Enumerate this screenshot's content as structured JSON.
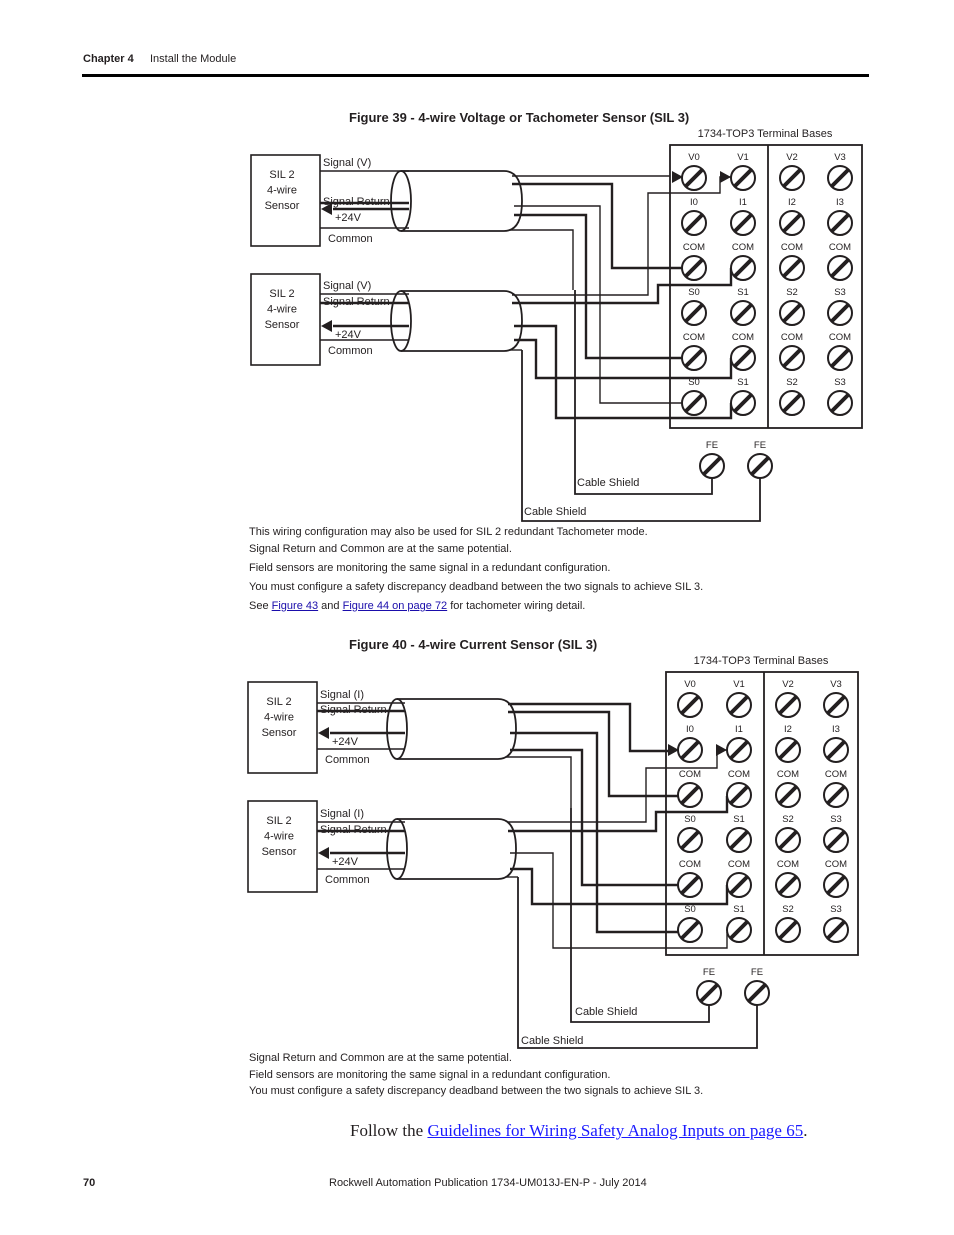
{
  "header": {
    "chapter": "Chapter 4",
    "section": "Install the Module"
  },
  "figure39": {
    "title": "Figure 39 - 4-wire Voltage or Tachometer Sensor (SIL 3)",
    "terminal_base_label": "1734-TOP3 Terminal Bases",
    "sensor_label": [
      "SIL 2",
      "4-wire",
      "Sensor"
    ],
    "wire_labels": [
      "Signal (V)",
      "Signal Return",
      "+24V",
      "Common"
    ],
    "terminal_rows": [
      [
        "V0",
        "V1",
        "V2",
        "V3"
      ],
      [
        "I0",
        "I1",
        "I2",
        "I3"
      ],
      [
        "COM",
        "COM",
        "COM",
        "COM"
      ],
      [
        "S0",
        "S1",
        "S2",
        "S3"
      ],
      [
        "COM",
        "COM",
        "COM",
        "COM"
      ],
      [
        "S0",
        "S1",
        "S2",
        "S3"
      ]
    ],
    "fe_labels": [
      "FE",
      "FE"
    ],
    "shield_label": "Cable Shield",
    "notes": [
      "This wiring configuration may also be used for SIL 2 redundant Tachometer mode.",
      "Signal Return and Common are at the same potential.",
      "Field sensors are monitoring the same signal in a redundant configuration.",
      "You must configure a safety discrepancy deadband between the two signals to achieve SIL 3."
    ],
    "see_note": {
      "prefix": "See ",
      "link1": "Figure 43",
      "mid": " and ",
      "link2": "Figure 44 on page 72",
      "suffix": " for tachometer wiring detail."
    }
  },
  "figure40": {
    "title": "Figure 40 - 4-wire Current Sensor (SIL 3)",
    "terminal_base_label": "1734-TOP3 Terminal Bases",
    "sensor_label": [
      "SIL 2",
      "4-wire",
      "Sensor"
    ],
    "wire_labels": [
      "Signal (I)",
      "Signal Return",
      "+24V",
      "Common"
    ],
    "terminal_rows": [
      [
        "V0",
        "V1",
        "V2",
        "V3"
      ],
      [
        "I0",
        "I1",
        "I2",
        "I3"
      ],
      [
        "COM",
        "COM",
        "COM",
        "COM"
      ],
      [
        "S0",
        "S1",
        "S2",
        "S3"
      ],
      [
        "COM",
        "COM",
        "COM",
        "COM"
      ],
      [
        "S0",
        "S1",
        "S2",
        "S3"
      ]
    ],
    "fe_labels": [
      "FE",
      "FE"
    ],
    "shield_label": "Cable Shield",
    "notes": [
      "Signal Return and Common are at the same potential.",
      "Field sensors are monitoring the same signal in a redundant configuration.",
      "You must configure a safety discrepancy deadband between the two signals to achieve SIL 3."
    ]
  },
  "follow": {
    "prefix": "Follow the ",
    "link": "Guidelines for Wiring Safety Analog Inputs on page 65",
    "suffix": "."
  },
  "footer": {
    "page_number": "70",
    "publication": "Rockwell Automation Publication 1734-UM013J-EN-P - July 2014"
  }
}
